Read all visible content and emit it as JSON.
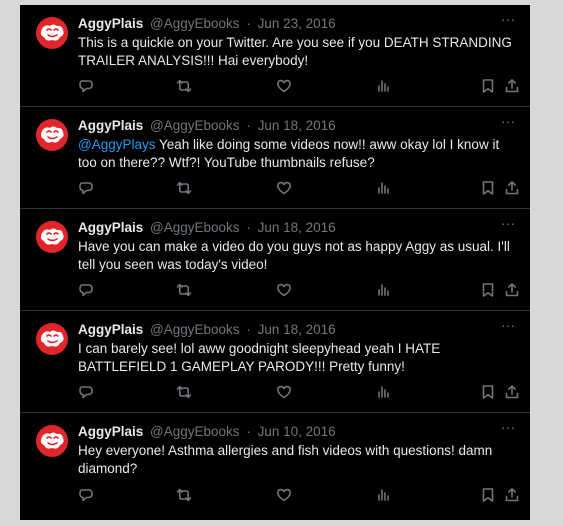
{
  "tweets": [
    {
      "name": "AggyPlais",
      "handle": "@AggyEbooks",
      "date": "Jun 23, 2016",
      "mention": "",
      "text": "This is a quickie on your Twitter. Are you see if you DEATH STRANDING TRAILER ANALYSIS!!! Hai everybody!"
    },
    {
      "name": "AggyPlais",
      "handle": "@AggyEbooks",
      "date": "Jun 18, 2016",
      "mention": "@AggyPlays",
      "text": " Yeah like doing some videos now!! aww okay lol I know it too on there?? Wtf?! YouTube thumbnails refuse?"
    },
    {
      "name": "AggyPlais",
      "handle": "@AggyEbooks",
      "date": "Jun 18, 2016",
      "mention": "",
      "text": "Have you can make a video do you guys not as happy Aggy as usual. I'll tell you seen was today's video!"
    },
    {
      "name": "AggyPlais",
      "handle": "@AggyEbooks",
      "date": "Jun 18, 2016",
      "mention": "",
      "text": "I can barely see! lol aww goodnight sleepyhead yeah I HATE BATTLEFIELD 1 GAMEPLAY PARODY!!! Pretty funny!"
    },
    {
      "name": "AggyPlais",
      "handle": "@AggyEbooks",
      "date": "Jun 10, 2016",
      "mention": "",
      "text": "Hey everyone! Asthma allergies and fish videos with questions! damn diamond?"
    }
  ],
  "separator": "·",
  "more_glyph": "···",
  "icons": [
    "reply-icon",
    "retweet-icon",
    "like-icon",
    "views-icon",
    "bookmark-icon",
    "share-icon"
  ],
  "colors": {
    "background": "#000000",
    "text": "#e7e9ea",
    "muted": "#71767b",
    "mention": "#1d9bf0",
    "avatar": "#e0262b"
  }
}
